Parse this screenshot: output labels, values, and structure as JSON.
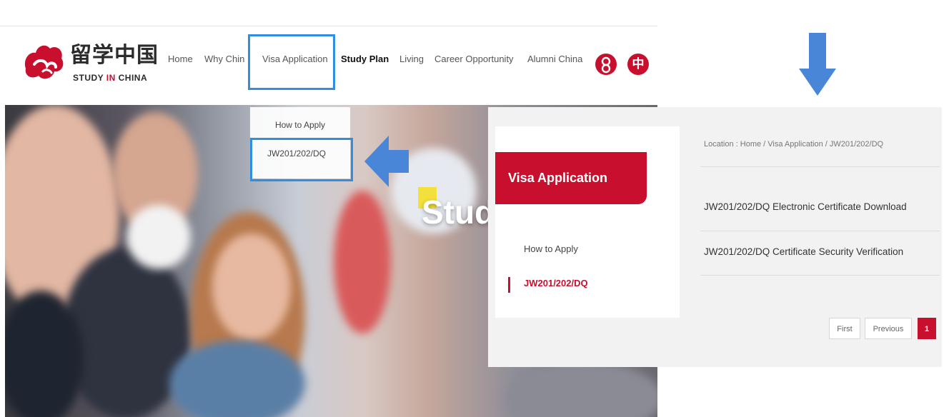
{
  "header": {
    "logo_cn": "留学中国",
    "logo_en_part1": "STUDY ",
    "logo_en_in": "IN",
    "logo_en_part2": " CHINA",
    "nav": [
      {
        "label": "Home"
      },
      {
        "label": "Why Chin"
      },
      {
        "label": "Visa Application"
      },
      {
        "label": "Study Plan"
      },
      {
        "label": "Living"
      },
      {
        "label": "Career Opportunity"
      },
      {
        "label": "Alumni China"
      }
    ],
    "lang_glyph": "中"
  },
  "dropdown": {
    "items": [
      {
        "label": "How to Apply"
      },
      {
        "label": "JW201/202/DQ"
      }
    ]
  },
  "hero": {
    "text": "Stud"
  },
  "detail": {
    "sidebar_title": "Visa Application",
    "sidebar_items": [
      {
        "label": "How to Apply"
      },
      {
        "label": "JW201/202/DQ"
      }
    ],
    "breadcrumb": "Location : Home / Visa Application / JW201/202/DQ",
    "links": [
      {
        "label": "JW201/202/DQ Electronic Certificate Download"
      },
      {
        "label": "JW201/202/DQ Certificate Security Verification"
      }
    ],
    "pagination": {
      "first": "First",
      "previous": "Previous",
      "current": "1"
    }
  },
  "colors": {
    "brand_red": "#c8102e",
    "highlight_blue": "#2f8ee0",
    "arrow_blue": "#4a86d8"
  },
  "icons": [
    "logo-mark-icon",
    "user-icon",
    "language-icon",
    "arrow-left-icon",
    "arrow-down-icon"
  ]
}
